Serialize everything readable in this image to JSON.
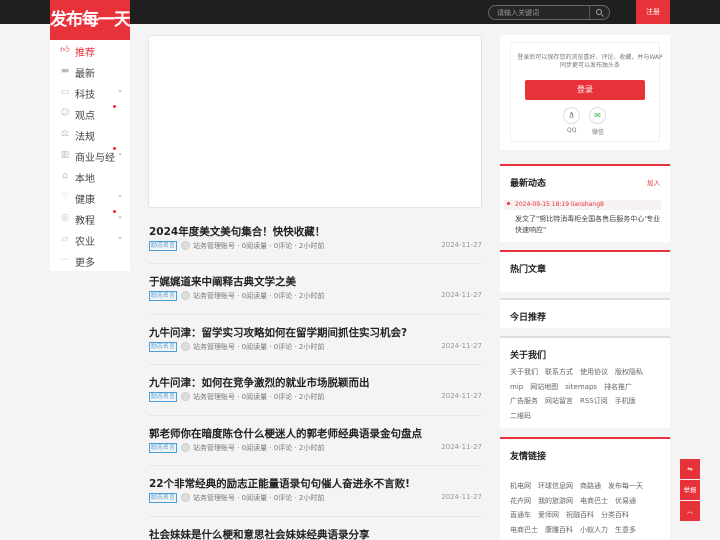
{
  "header": {
    "logo": "发布每一天",
    "search_placeholder": "请输入关键词",
    "register": "注册"
  },
  "sidebar": {
    "items": [
      {
        "label": "推荐",
        "icon": "thumbs-up-icon",
        "active": true
      },
      {
        "label": "最新",
        "icon": "folder-icon"
      },
      {
        "label": "科技",
        "icon": "monitor-icon",
        "chevron": true
      },
      {
        "label": "观点",
        "icon": "smile-icon",
        "dot": true
      },
      {
        "label": "法规",
        "icon": "scale-icon"
      },
      {
        "label": "商业与经",
        "icon": "chart-icon",
        "chevron": true,
        "dot": true
      },
      {
        "label": "本地",
        "icon": "location-icon"
      },
      {
        "label": "健康",
        "icon": "heart-icon",
        "chevron": true
      },
      {
        "label": "教程",
        "icon": "book-icon",
        "chevron": true,
        "dot": true
      },
      {
        "label": "农业",
        "icon": "leaf-icon",
        "chevron": true
      },
      {
        "label": "更多",
        "icon": "more-icon"
      }
    ]
  },
  "articles": [
    {
      "title": "2024年度美文美句集合！快快收藏！",
      "tag": "励志名言",
      "meta": "站务管理账号 · 0阅读量 · 0评论 · 2小时前",
      "date": "2024-11-27"
    },
    {
      "title": "于娓娓道来中阐释古典文学之美",
      "tag": "励志名言",
      "meta": "站务管理账号 · 0阅读量 · 0评论 · 2小时前",
      "date": "2024-11-27"
    },
    {
      "title": "九牛问津：留学实习攻略如何在留学期间抓住实习机会?",
      "tag": "励志名言",
      "meta": "站务管理账号 · 0阅读量 · 0评论 · 2小时前",
      "date": "2024-11-27"
    },
    {
      "title": "九牛问津：如何在竞争激烈的就业市场脱颖而出",
      "tag": "励志名言",
      "meta": "站务管理账号 · 0阅读量 · 0评论 · 2小时前",
      "date": "2024-11-27"
    },
    {
      "title": "郭老师你在暗度陈仓什么梗迷人的郭老师经典语录金句盘点",
      "tag": "励志名言",
      "meta": "站务管理账号 · 0阅读量 · 0评论 · 2小时前",
      "date": "2024-11-27"
    },
    {
      "title": "22个非常经典的励志正能量语录句句催人奋进永不言败!",
      "tag": "励志名言",
      "meta": "站务管理账号 · 0阅读量 · 0评论 · 2小时前",
      "date": "2024-11-27"
    },
    {
      "title": "社会妹妹是什么梗和意思社会妹妹经典语录分享",
      "tag": "",
      "meta": "",
      "date": ""
    }
  ],
  "login": {
    "tip": "登录后可以保存您的浏览喜好、评论、收藏，并与WAP同步更可以发布独头条",
    "button": "登录",
    "qq": "QQ",
    "wechat": "微信"
  },
  "latest": {
    "heading": "最新动态",
    "add": "加入",
    "date": "2024-09-15 18:19 lianshang8",
    "text": "发文了\"努比特消毒柜全国各售后服务中心'专业快速响应\""
  },
  "hot": {
    "heading": "热门文章"
  },
  "today": {
    "heading": "今日推荐"
  },
  "about": {
    "heading": "关于我们",
    "links": [
      "关于我们",
      "联系方式",
      "使用协议",
      "版权隐私",
      "mip",
      "网站地图",
      "sitemaps",
      "排名推广",
      "广告服务",
      "网站留言",
      "RSS订阅",
      "手机版",
      "二维码"
    ]
  },
  "friends": {
    "heading": "友情链接",
    "links": [
      "机电网",
      "环球信息网",
      "商路通",
      "发布每一天",
      "花卉网",
      "我的旅游网",
      "电商巴士",
      "优易通",
      "直通车",
      "爱师网",
      "祝融百科",
      "分类百科",
      "电商巴士",
      "康雕百科",
      "小蚁人力",
      "生意多"
    ]
  },
  "float": {
    "share": "⇋",
    "report": "举报",
    "top": "︿"
  },
  "colors": {
    "accent": "#e8323a",
    "topbar": "#1f1f1f",
    "tag": "#4a9fd8"
  }
}
